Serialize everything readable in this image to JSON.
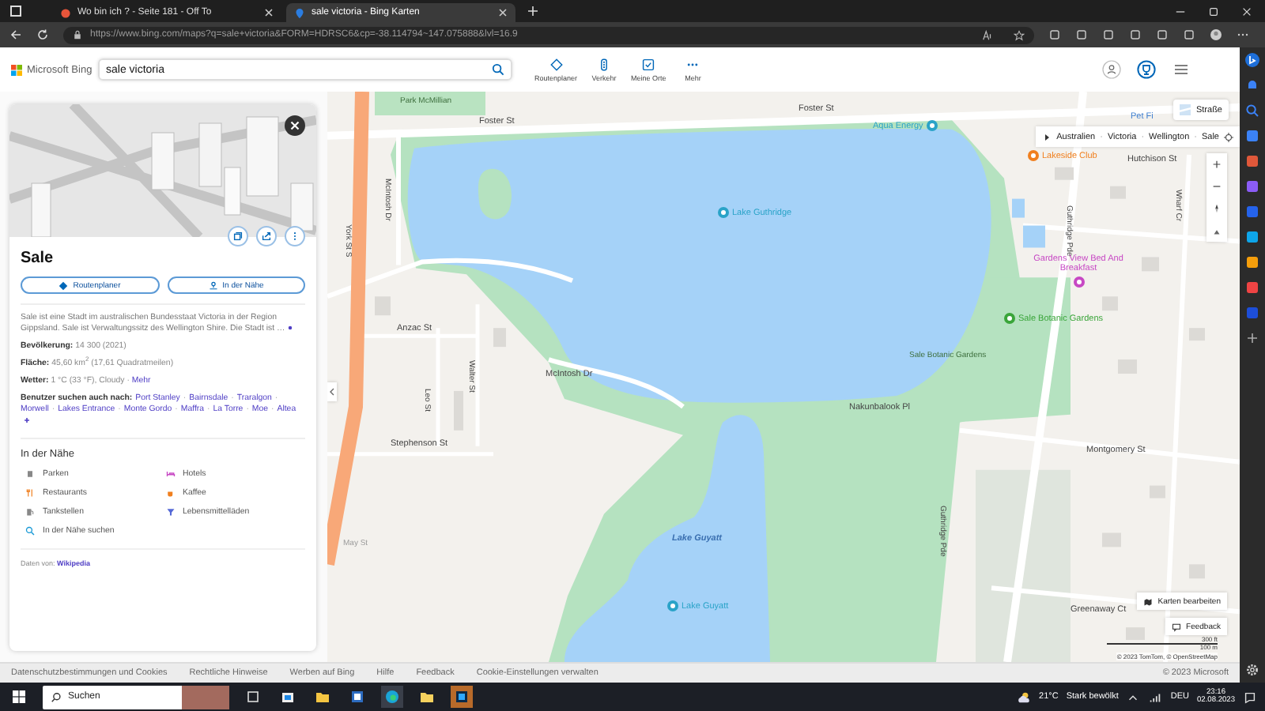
{
  "browser": {
    "tabs": [
      {
        "title": "Wo bin ich ? - Seite 181 - Off To",
        "selected": false
      },
      {
        "title": "sale victoria - Bing Karten",
        "selected": true
      }
    ],
    "address": "https://www.bing.com/maps?q=sale+victoria&FORM=HDRSC6&cp=-38.114794~147.075888&lvl=16.9"
  },
  "header": {
    "logo": "Microsoft Bing",
    "search": {
      "value": "sale victoria"
    },
    "nav": [
      "Routenplaner",
      "Verkehr",
      "Meine Orte",
      "Mehr"
    ]
  },
  "panel": {
    "title": "Sale",
    "buttons": [
      "Routenplaner",
      "In der Nähe"
    ],
    "description": "Sale ist eine Stadt im australischen Bundesstaat Victoria in der Region Gippsland. Sale ist Verwaltungssitz des Wellington Shire. Die Stadt ist …",
    "facts": [
      {
        "label": "Bevölkerung:",
        "value": "14 300 (2021)"
      },
      {
        "label": "Fläche:",
        "value": "45,60 km$^{2}$ (17,61 Quadratmeilen)"
      },
      {
        "label": "Wetter:",
        "value": "1 °C (33 °F), Cloudy ·",
        "link": "Mehr"
      }
    ],
    "related": {
      "label": "Benutzer suchen auch nach:",
      "separator": "·",
      "links": [
        "Port Stanley",
        "Bairnsdale",
        "Traralgon",
        "Morwell",
        "Lakes Entrance",
        "Monte Gordo",
        "Maffra",
        "La Torre",
        "Moe",
        "Altea"
      ]
    },
    "nearby": {
      "title": "In der Nähe",
      "items": [
        "Parken",
        "Hotels",
        "Restaurants",
        "Kaffee",
        "Tankstellen",
        "Lebensmittelläden"
      ],
      "search": "In der Nähe suchen"
    },
    "source": {
      "label": "Daten von:",
      "link": "Wikipedia"
    }
  },
  "map": {
    "style_button": "Straße",
    "breadcrumb_separator": "·",
    "breadcrumb": [
      "Australien",
      "Victoria",
      "Wellington",
      "Sale"
    ],
    "labels": [
      {
        "text": "Park McMillian",
        "kind": "park"
      },
      {
        "text": "Foster St",
        "kind": "street"
      },
      {
        "text": "Foster St",
        "kind": "street"
      },
      {
        "text": "York St S",
        "kind": "vertical"
      },
      {
        "text": "McIntosh Dr",
        "kind": "vertical"
      },
      {
        "text": "Anzac St",
        "kind": "street"
      },
      {
        "text": "Leo St",
        "kind": "vertical"
      },
      {
        "text": "Walter St",
        "kind": "vertical"
      },
      {
        "text": "McIntosh Dr",
        "kind": "street"
      },
      {
        "text": "Stephenson St",
        "kind": "street"
      },
      {
        "text": "May St",
        "kind": "faint"
      },
      {
        "text": "Lake Guyatt",
        "kind": "water"
      },
      {
        "text": "Nakunbalook Pl",
        "kind": "street"
      },
      {
        "text": "Sale Botanic Gardens",
        "kind": "park"
      },
      {
        "text": "Hutchison St",
        "kind": "street"
      },
      {
        "text": "Guthridge Pde",
        "kind": "vertical"
      },
      {
        "text": "Wharf Cr",
        "kind": "vertical"
      },
      {
        "text": "Guthridge Pde",
        "kind": "vertical"
      },
      {
        "text": "Montgomery St",
        "kind": "street"
      },
      {
        "text": "Greenaway Ct",
        "kind": "street"
      },
      {
        "text": "Pet Fi",
        "kind": "place"
      }
    ],
    "pois": [
      {
        "text": "Aqua Energy",
        "color": "#2aa3c8"
      },
      {
        "text": "Lakeside Club",
        "color": "#f07f1e"
      },
      {
        "text": "Lake Guthridge",
        "color": "#2aa3c8"
      },
      {
        "text": "Gardens View Bed And Breakfast",
        "color": "#c748c4"
      },
      {
        "text": "Sale Botanic Gardens",
        "color": "#3aa53a"
      },
      {
        "text": "Lake Guyatt",
        "color": "#2aa3c8"
      }
    ],
    "edit_button": "Karten bearbeiten",
    "feedback_button": "Feedback",
    "scale": [
      "300 ft",
      "100 m"
    ],
    "copyright": "© 2023 TomTom, © OpenStreetMap"
  },
  "footer": {
    "links": [
      "Datenschutzbestimmungen und Cookies",
      "Rechtliche Hinweise",
      "Werben auf Bing",
      "Hilfe",
      "Feedback",
      "Cookie-Einstellungen verwalten"
    ],
    "copyright": "© 2023 Microsoft"
  },
  "taskbar": {
    "search_placeholder": "Suchen",
    "temperature": "21°C",
    "weather": "Stark bewölkt",
    "language": "DEU",
    "time": "23:16",
    "date": "02.08.2023"
  }
}
